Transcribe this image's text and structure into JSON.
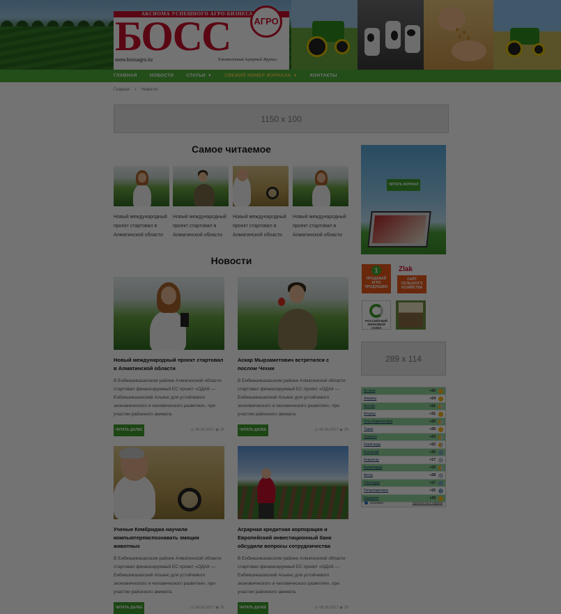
{
  "header": {
    "tagline": "АКСИОМА УСПЕШНОГО АГРО-БИЗНЕСА",
    "logo_word": "БОСС",
    "logo_seal": "АГРО",
    "url": "www.bossagro.kz",
    "subtitle": "Ежемесячный Аграрный Журнал"
  },
  "nav": {
    "items": [
      "ГЛАВНАЯ",
      "НОВОСТИ",
      "СТАТЬИ",
      "СВЕЖИЙ НОМЕР ЖУРНАЛА",
      "КОНТАКТЫ"
    ],
    "caret": "▼"
  },
  "breadcrumb": [
    "Главная",
    "/",
    "Новости"
  ],
  "ads": {
    "top": "1150 x 100",
    "side": "289 x 114"
  },
  "popular": {
    "title": "Самое читаемое",
    "items": [
      {
        "text": "Новый международный проект стартовал в Алматинской области"
      },
      {
        "text": "Новый международный проект стартовал в Алматинской области"
      },
      {
        "text": "Новый международный проект стартовал в Алматинской области"
      },
      {
        "text": "Новый международный проект стартовал в Алматинской области"
      }
    ]
  },
  "news": {
    "title": "Новости",
    "read_more": "ЧИТАТЬ ДАЛЕЕ",
    "items": [
      {
        "title": "Новый международный проект стартовал в Алматинской области",
        "excerpt": "В Енбекшиказахском районе Алматинской области стартовал финансируемый ЕС проект «ОДАК — Енбекшиказахский Альянс для устойчивого экономического и человеческого развития», при участии районного акимата.",
        "date": "08.06.2017",
        "views": "25"
      },
      {
        "title": "Аскар Мырзаметович встретился с послом Чехии",
        "excerpt": "В Енбекшиказахском районе Алматинской области стартовал финансируемый ЕС проект «ОДАК — Енбекшиказахский Альянс для устойчивого экономического и человеческого развития», при участии районного акимата.",
        "date": "08.06.2017",
        "views": "25"
      },
      {
        "title": "Ученые Кембриджа научили компьютерпаспознавать эмоции животных",
        "excerpt": "В Енбекшиказахском районе Алматинской области стартовал финансируемый ЕС проект «ОДАК — Енбекшиказахский Альянс для устойчивого экономического и человеческого развития», при участии районного акимата.",
        "date": "08.06.2017",
        "views": "25"
      },
      {
        "title": "Аграрная кредитная корпорация и Европейский инвестиционный банк обсудили вопросы сотрудничества",
        "excerpt": "В Енбекшиказахском районе Алматинской области стартовал финансируемый ЕС проект «ОДАК — Енбекшиказахский Альянс для устойчивого экономического и человеческого развития», при участии районного акимата.",
        "date": "08.06.2017",
        "views": "25"
      }
    ]
  },
  "sidebar": {
    "magazine_button": "ЧИТАТЬ ЖУРНАЛ",
    "partners": {
      "sell_num": "1",
      "sell_text": "ПРОДАВАЙ АГРО ПРОДУКЦИЮ",
      "zlak_logo": "Zlak",
      "zlak_text": "САЙТ СЕЛЬСКОГО ХОЗЯЙСТВА",
      "rzs_text": "РОССИЙСКИЙ ЗЕРНОВОЙ СОЮЗ"
    }
  },
  "weather": {
    "rows": [
      {
        "city": "Астана",
        "temp": "+25",
        "icon": "sun"
      },
      {
        "city": "Алматы",
        "temp": "+24",
        "icon": "sun"
      },
      {
        "city": "Актобе",
        "temp": "+21",
        "icon": "part"
      },
      {
        "city": "Атырау",
        "temp": "+31",
        "icon": "sun"
      },
      {
        "city": "Усть-Каменогорск",
        "temp": "+20",
        "icon": "part"
      },
      {
        "city": "Тараз",
        "temp": "+26",
        "icon": "sun"
      },
      {
        "city": "Уральск",
        "temp": "+23",
        "icon": "part"
      },
      {
        "city": "Караганда",
        "temp": "+22",
        "icon": "part"
      },
      {
        "city": "Костанай",
        "temp": "+16",
        "icon": "rain"
      },
      {
        "city": "Кокшетау",
        "temp": "+17",
        "icon": "cloud"
      },
      {
        "city": "Кызылорда",
        "temp": "+33",
        "icon": "part"
      },
      {
        "city": "Актау",
        "temp": "+28",
        "icon": "cloud"
      },
      {
        "city": "Павлодар",
        "temp": "+17",
        "icon": "rain"
      },
      {
        "city": "Петропавловск",
        "temp": "+15",
        "icon": "rain"
      },
      {
        "city": "Шымкент",
        "temp": "+29",
        "icon": "sun"
      }
    ],
    "footer_left": "Gismeteo",
    "footer_right": "Прогноз на 2 недели"
  },
  "colors": {
    "brand_red": "#c8102e",
    "nav_green": "#4fae3b",
    "button_green": "#3e9b2e"
  }
}
